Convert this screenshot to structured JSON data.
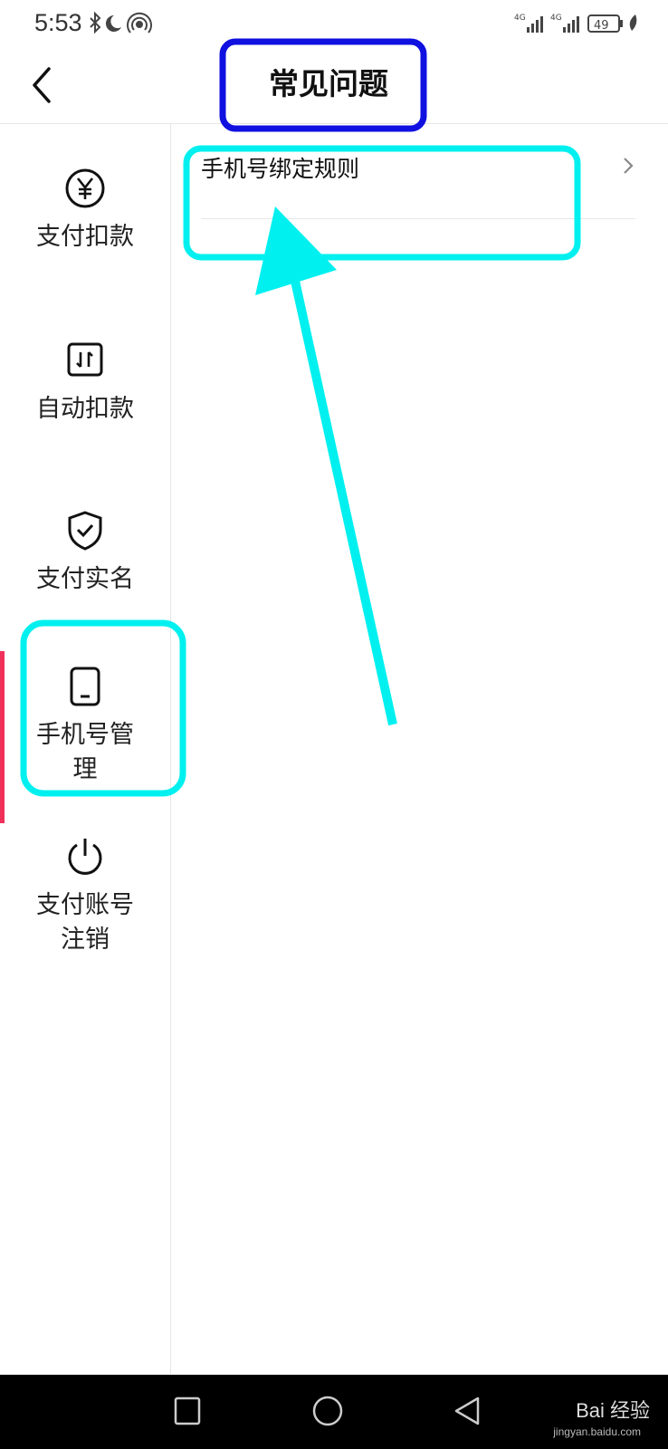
{
  "status_bar": {
    "time": "5:53",
    "battery": "49"
  },
  "header": {
    "title": "常见问题"
  },
  "sidebar": {
    "items": [
      {
        "label": "支付扣款",
        "icon": "yen-icon"
      },
      {
        "label": "自动扣款",
        "icon": "auto-deduct-icon"
      },
      {
        "label": "支付实名",
        "icon": "shield-check-icon"
      },
      {
        "label": "手机号管理",
        "icon": "phone-icon",
        "active": true
      },
      {
        "label": "支付账号注销",
        "icon": "power-icon"
      }
    ]
  },
  "content": {
    "faq_items": [
      {
        "text": "手机号绑定规则"
      }
    ]
  },
  "watermark": {
    "text": "Bai 经验",
    "sub": "jingyan.baidu.com"
  },
  "colors": {
    "active_indicator": "#f0305a",
    "annotation_cyan": "#00f0f0",
    "annotation_blue": "#1010e0"
  }
}
